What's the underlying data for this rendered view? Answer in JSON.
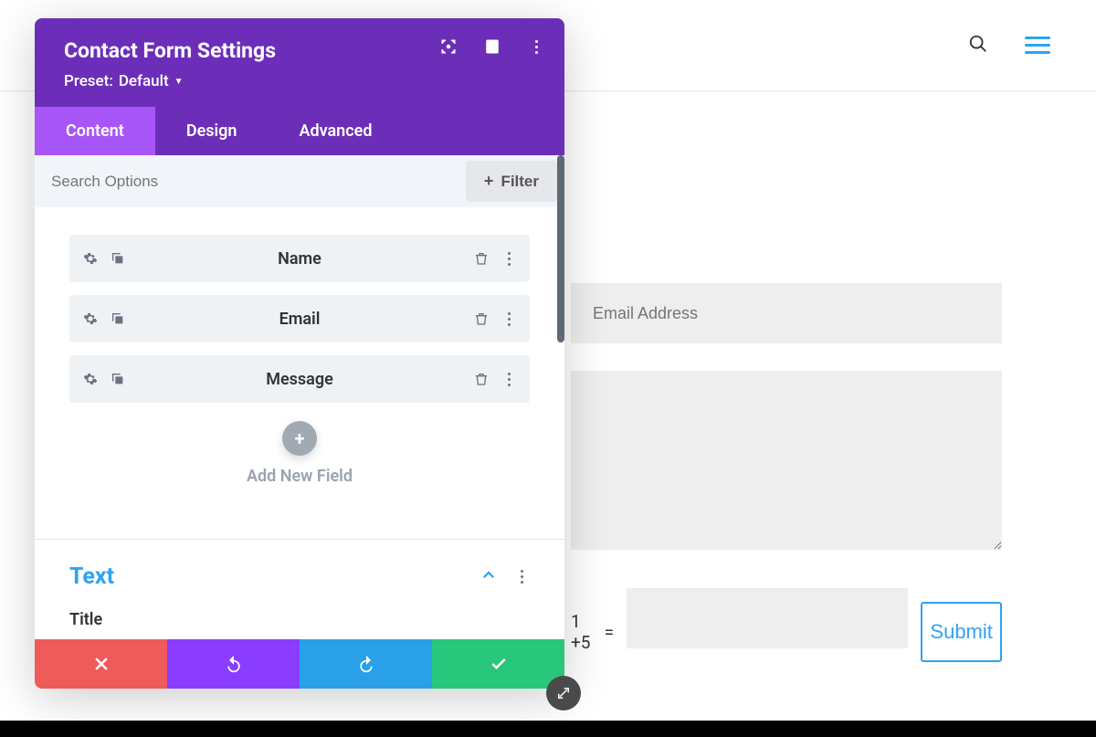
{
  "site": {
    "search_label": "Search",
    "menu_label": "Menu"
  },
  "preview": {
    "email_placeholder": "Email Address",
    "captcha_q": "1 +5",
    "captcha_eq": "=",
    "submit_label": "Submit"
  },
  "modal": {
    "title": "Contact Form Settings",
    "preset_prefix": "Preset:",
    "preset_value": "Default",
    "tabs": {
      "content": "Content",
      "design": "Design",
      "advanced": "Advanced"
    },
    "search_placeholder": "Search Options",
    "filter_label": "Filter",
    "fields": [
      {
        "label": "Name"
      },
      {
        "label": "Email"
      },
      {
        "label": "Message"
      }
    ],
    "add_field_label": "Add New Field",
    "text_section_title": "Text",
    "title_label": "Title"
  }
}
